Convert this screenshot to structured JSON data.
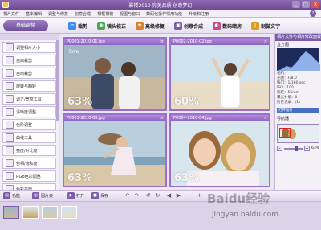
{
  "app": {
    "title": "影楼2010 完美品质 创意梦幻",
    "window_buttons": {
      "minimize": "_",
      "maximize": "□",
      "close": "×"
    }
  },
  "menu": {
    "items": [
      "相片文件",
      "基本编辑",
      "调整与修复",
      "创意合成",
      "相框相馆",
      "视图与窗口",
      "数码化操作常用功能",
      "升级和注册"
    ],
    "help_label": "?"
  },
  "toolbar": {
    "mode_label": "基础调整",
    "tools": [
      {
        "label": "裁剪",
        "icon": "crop-icon",
        "color": "#3a8ee6"
      },
      {
        "label": "镜头校正",
        "icon": "lens-icon",
        "color": "#4aa84a"
      },
      {
        "label": "高级修复",
        "icon": "repair-icon",
        "color": "#d9842a"
      },
      {
        "label": "创意合成",
        "icon": "composite-icon",
        "color": "#7a5ca8"
      },
      {
        "label": "数码暗房",
        "icon": "darkroom-icon",
        "color": "#c94a8a"
      },
      {
        "label": "制做文字",
        "icon": "text-icon",
        "color": "#d6a21e"
      }
    ]
  },
  "left_panel": {
    "items": [
      "调整相片大小",
      "自由裁剪",
      "自动裁剪",
      "旋转与翻转",
      "调正/宽窄工具",
      "清晰度调整",
      "色阶调整",
      "曲线工具",
      "亮度/对比度",
      "色相/饱和度",
      "RGB色彩调整",
      "色彩平衡"
    ]
  },
  "photos": [
    {
      "filename": "P0001-2010-01.jpg",
      "percent": "63%",
      "caption": "love"
    },
    {
      "filename": "P0002-2010-02.jpg",
      "percent": "60%"
    },
    {
      "filename": "P0003-2010-03.jpg",
      "percent": "63%"
    },
    {
      "filename": "P0004-2010-04.jpg",
      "percent": "63%"
    }
  ],
  "right_panel": {
    "header": "相片文件与相片修改面板",
    "histogram_label": "直方图",
    "info_rows": [
      "相机：",
      "光圈：F/8.0",
      "快门：1/160 sec",
      "ISO：100",
      "焦距：55mm",
      "曝光补偿：0",
      "历史记录：(1)"
    ],
    "history_item": "打开图片",
    "navigator_label": "导航器",
    "zoom": {
      "value": "63%",
      "level": 0.63,
      "minus": "-",
      "plus": "+"
    }
  },
  "bottom_bar": {
    "buttons": [
      "功能",
      "图片夹",
      "打开",
      "保存"
    ],
    "zoom_buttons": {
      "minus": "-",
      "plus": "+"
    }
  },
  "watermark": {
    "text": "Baidu经验",
    "url": "jingyan.baidu.com"
  }
}
